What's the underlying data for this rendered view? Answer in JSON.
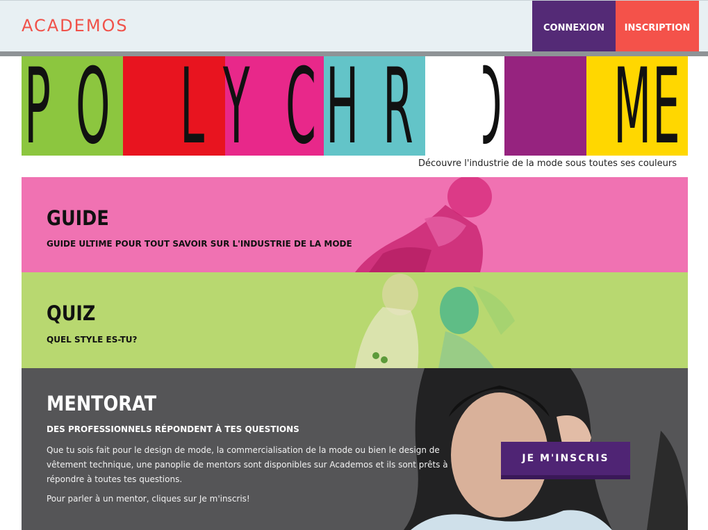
{
  "header": {
    "logo": "ACADEMOS",
    "login_label": "CONNEXION",
    "signup_label": "INSCRIPTION"
  },
  "banner": {
    "letters": [
      "P",
      "O",
      "L",
      "Y",
      "C",
      "H",
      "R",
      "O",
      "M",
      "E"
    ],
    "tagline": "Découvre l'industrie de la mode sous toutes ses couleurs",
    "colors": [
      "#8cc63f",
      "#e8141f",
      "#e8288a",
      "#63c4c8",
      "#ffffff",
      "#96237f",
      "#ffd700"
    ]
  },
  "sections": {
    "guide": {
      "title": "GUIDE",
      "subtitle": "GUIDE ULTIME POUR TOUT SAVOIR SUR L'INDUSTRIE DE LA MODE",
      "color": "#f072b2"
    },
    "quiz": {
      "title": "QUIZ",
      "subtitle": "QUEL STYLE ES-TU?",
      "color": "#b8d870"
    },
    "mentorat": {
      "title": "MENTORAT",
      "subtitle": "DES PROFESSIONNELS RÉPONDENT À TES QUESTIONS",
      "body": "Que tu sois fait pour le design de mode, la commercialisation de la mode ou bien le design de vêtement technique, une panoplie de mentors sont disponibles sur Academos et ils sont prêts à répondre à toutes tes questions.",
      "body2": "Pour parler à un mentor, cliques sur Je m'inscris!",
      "cta_label": "JE M'INSCRIS",
      "color": "#555557"
    }
  }
}
